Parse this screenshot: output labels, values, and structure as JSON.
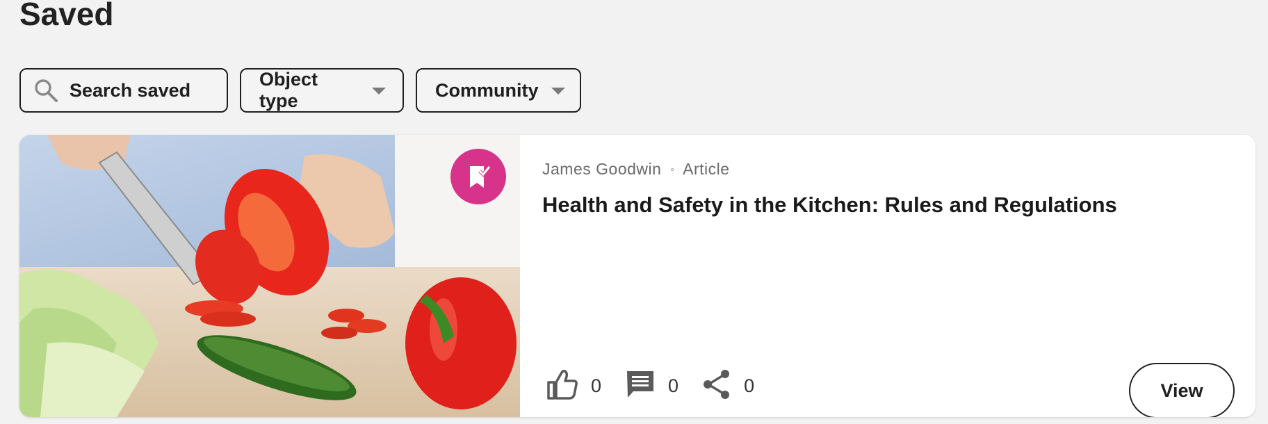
{
  "page": {
    "title": "Saved"
  },
  "filters": {
    "search_label": "Search saved",
    "object_type_label": "Object type",
    "community_label": "Community"
  },
  "card": {
    "author": "James Goodwin",
    "separator": "◦",
    "type": "Article",
    "title": "Health and Safety in the Kitchen: Rules and Regulations",
    "likes": "0",
    "comments": "0",
    "shares": "0",
    "view_label": "View",
    "badge_icon": "bookmark-check-icon",
    "badge_color": "#d8338a"
  },
  "colors": {
    "background": "#f2f2f2",
    "card": "#ffffff",
    "text": "#1a1a1a",
    "muted": "#6a6a6a"
  }
}
